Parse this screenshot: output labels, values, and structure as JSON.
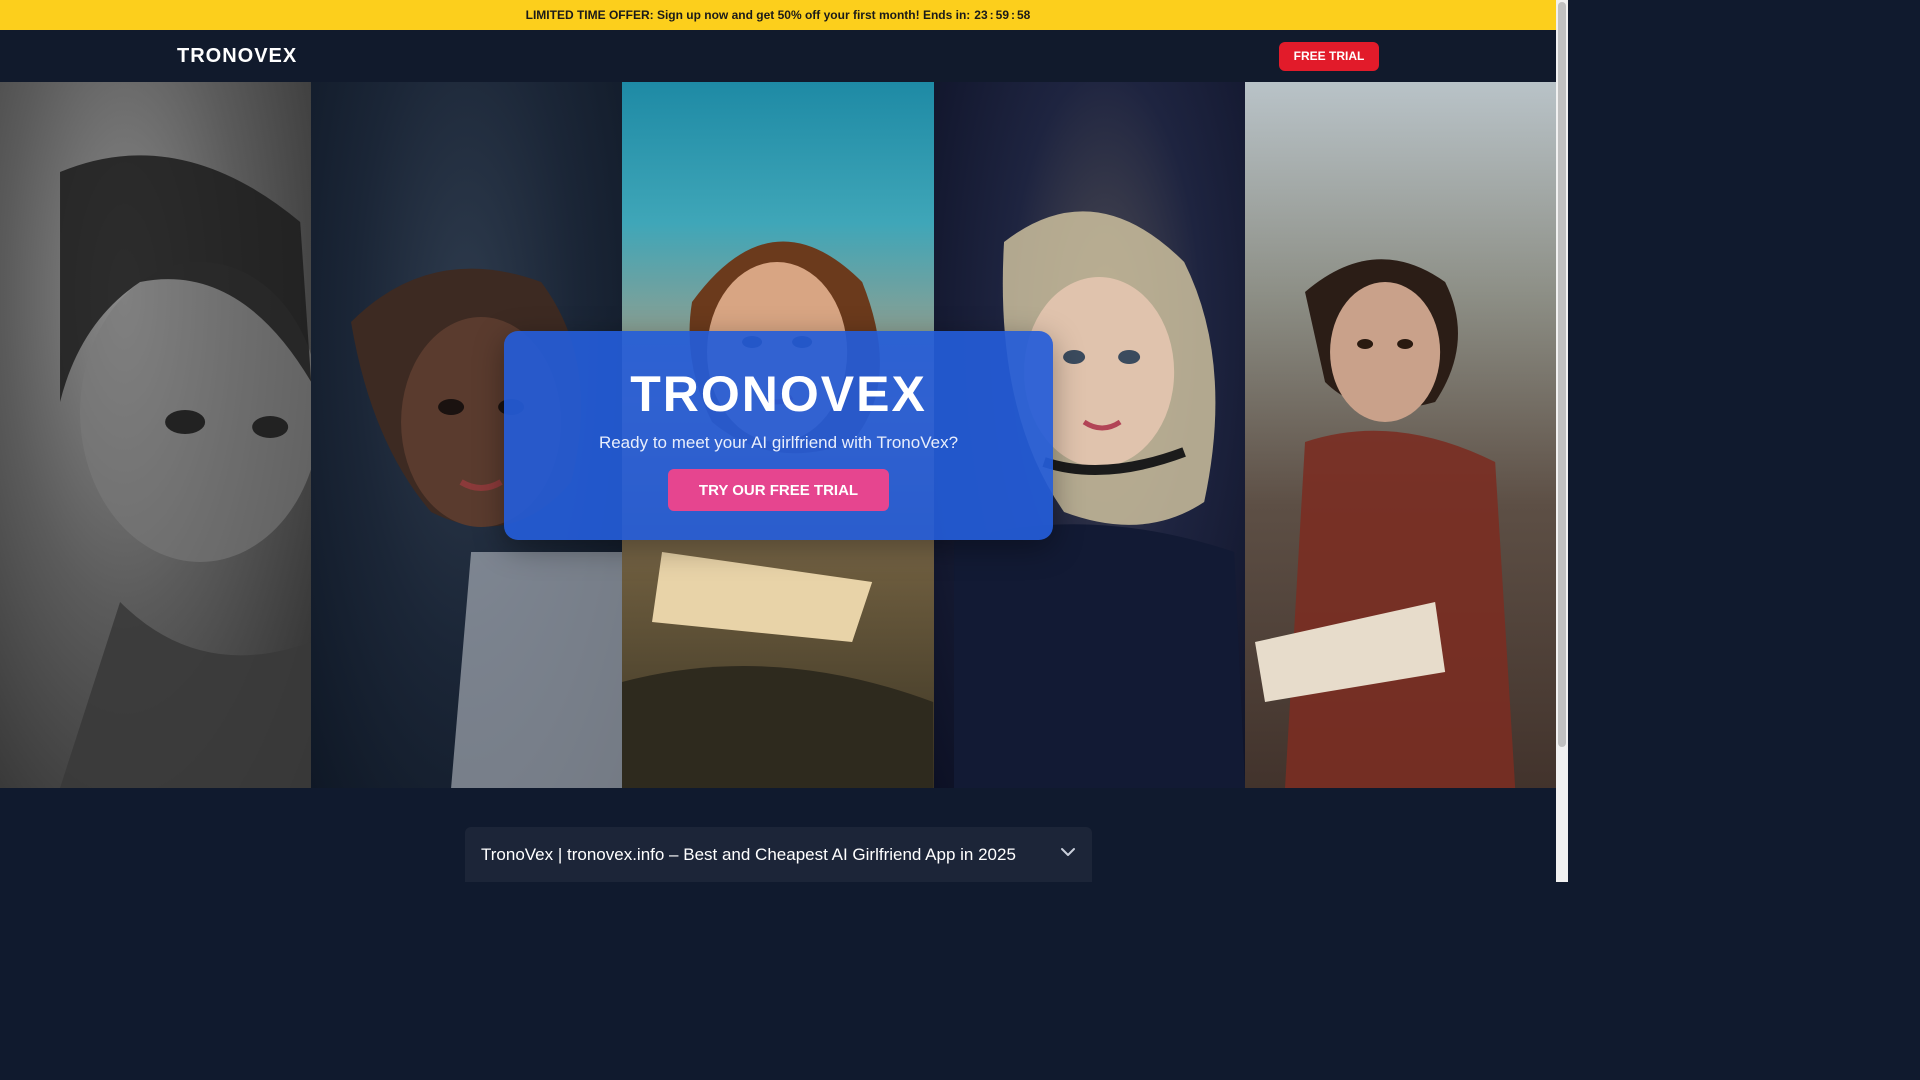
{
  "promo": {
    "text": "LIMITED TIME OFFER: Sign up now and get 50% off your first month! Ends in:",
    "timer": {
      "hours": "23",
      "sep1": ":",
      "minutes": "59",
      "sep2": ":",
      "seconds": "58"
    }
  },
  "navbar": {
    "logo": "TRONOVEX",
    "cta_label": "FREE TRIAL"
  },
  "hero": {
    "title": "TRONOVEX",
    "subtitle": "Ready to meet your AI girlfriend with TronoVex?",
    "cta_label": "TRY OUR FREE TRIAL"
  },
  "faq": {
    "items": [
      {
        "title": "TronoVex | tronovex.info – Best and Cheapest AI Girlfriend App in 2025"
      }
    ]
  },
  "colors": {
    "promo_bg": "#fccf1c",
    "nav_bg": "#111a2c",
    "nav_cta": "#e21b2a",
    "card_bg": "#245cd8",
    "hero_cta": "#e6458f"
  },
  "icons": {
    "faq_toggle": "chevron-down-icon"
  }
}
